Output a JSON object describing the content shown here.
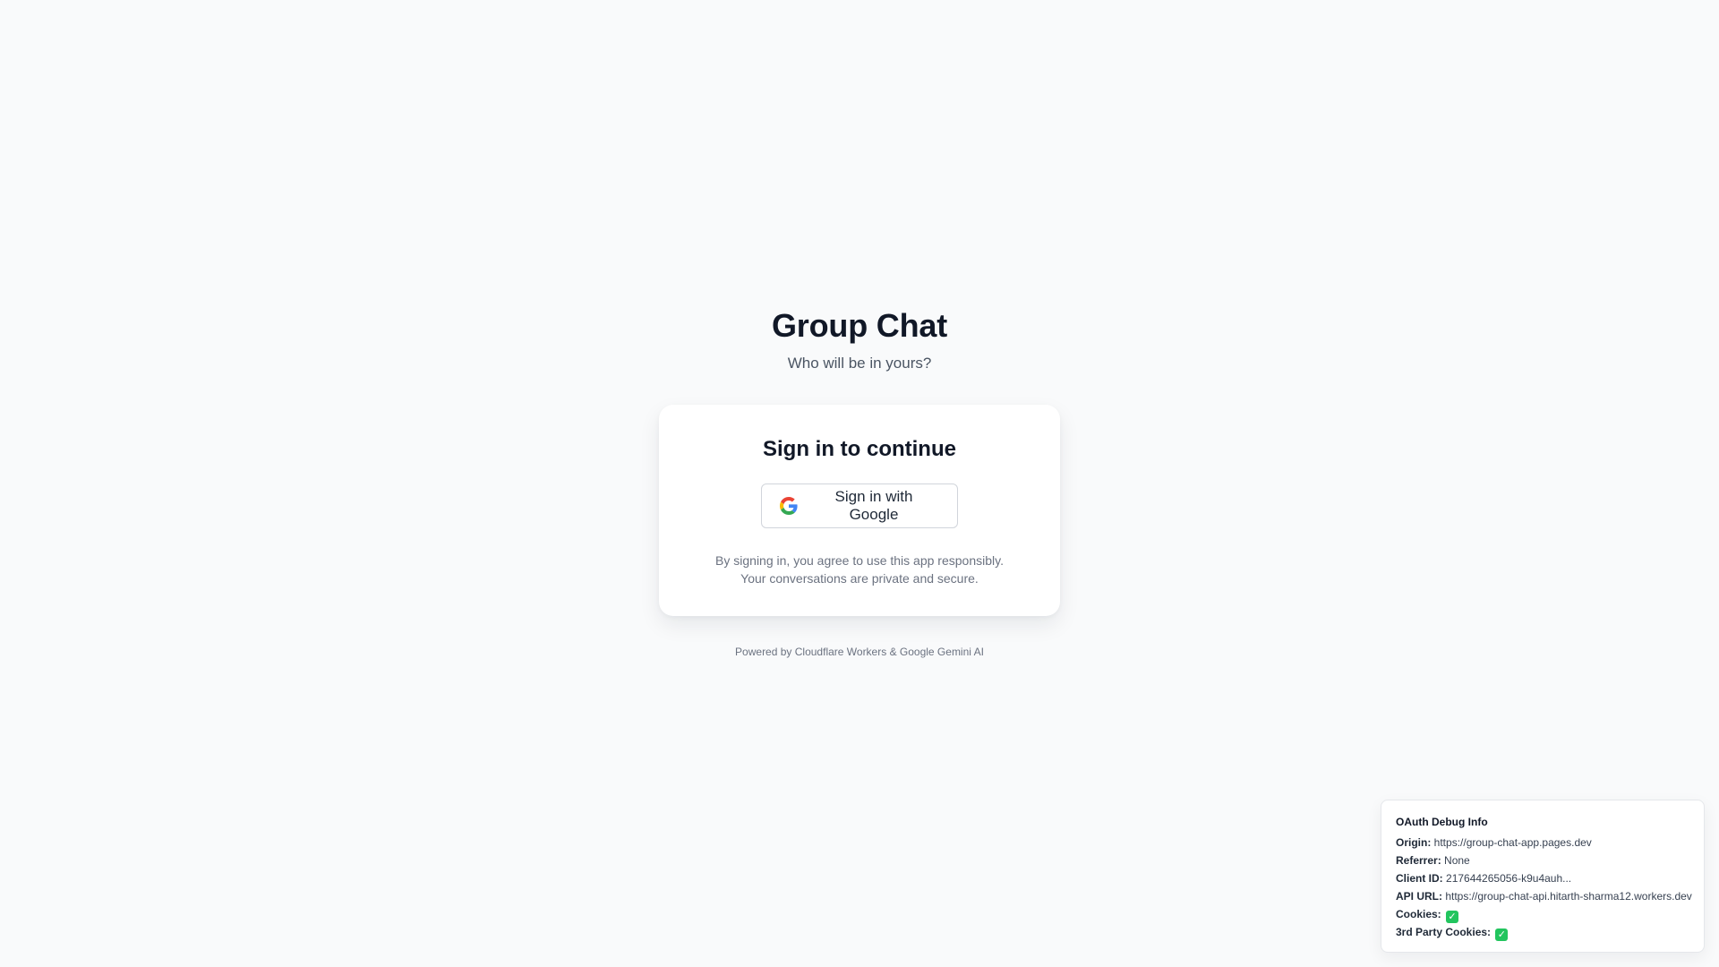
{
  "app": {
    "title": "Group Chat",
    "subtitle": "Who will be in yours?"
  },
  "card": {
    "title": "Sign in to continue",
    "google_button_label": "Sign in with Google",
    "google_icon": "google-g-icon",
    "terms": "By signing in, you agree to use this app responsibly. Your conversations are private and secure."
  },
  "footer": {
    "text": "Powered by Cloudflare Workers & Google Gemini AI"
  },
  "debug": {
    "title": "OAuth Debug Info",
    "rows": [
      {
        "label": "Origin:",
        "value": "https://group-chat-app.pages.dev"
      },
      {
        "label": "Referrer:",
        "value": "None"
      },
      {
        "label": "Client ID:",
        "value": "217644265056-k9u4auh..."
      },
      {
        "label": "API URL:",
        "value": "https://group-chat-api.hitarth-sharma12.workers.dev"
      },
      {
        "label": "Cookies:",
        "value": "✓"
      },
      {
        "label": "3rd Party Cookies:",
        "value": "✓"
      }
    ]
  },
  "colors": {
    "page_background": "#f9fafb",
    "heading": "#111827",
    "muted_text": "#6b7280",
    "card_background": "#ffffff",
    "button_border": "#d1d5db",
    "check_green": "#22c55e"
  }
}
